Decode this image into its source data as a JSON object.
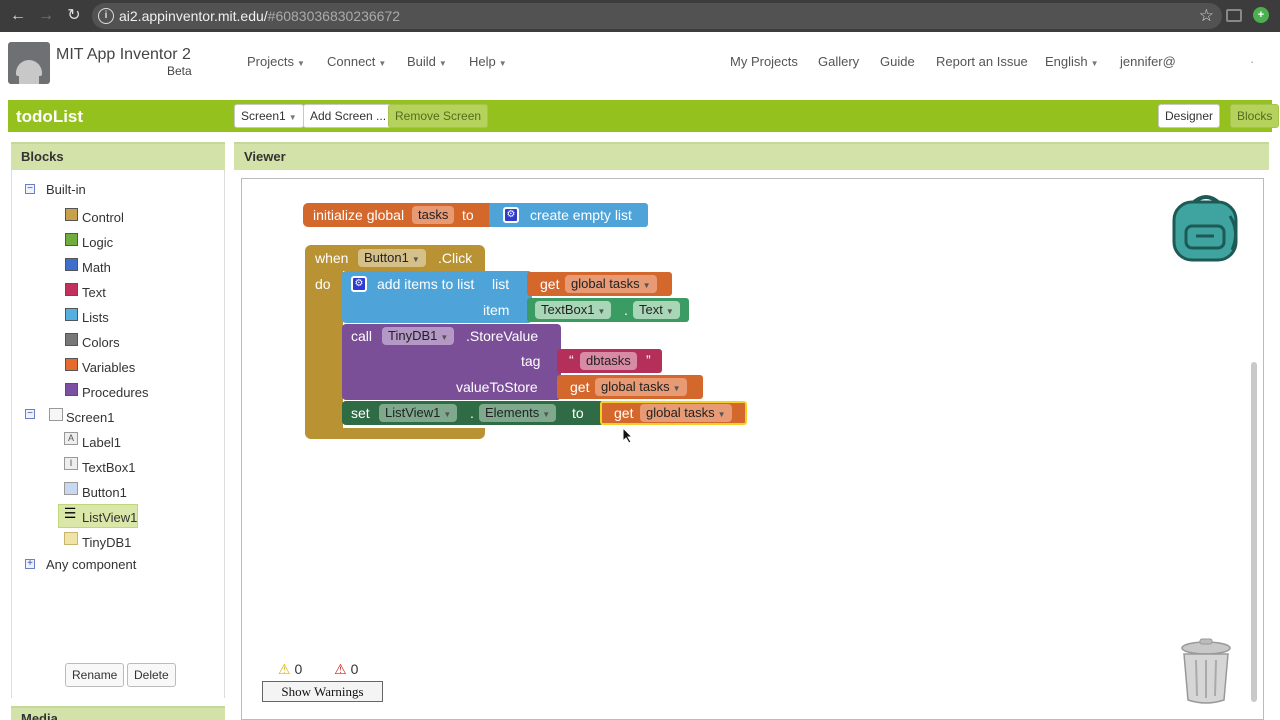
{
  "browser": {
    "url_host": "ai2.appinventor.mit.edu/",
    "url_hash": "#6083036830236672"
  },
  "app": {
    "brand_title": "MIT App Inventor 2",
    "brand_sub": "Beta",
    "menus": [
      "Projects",
      "Connect",
      "Build",
      "Help"
    ],
    "right_links": [
      "My Projects",
      "Gallery",
      "Guide",
      "Report an Issue"
    ],
    "language": "English",
    "user": "jennifer@",
    "extra": "·"
  },
  "toolbar": {
    "project_name": "todoList",
    "screen_select": "Screen1",
    "add_screen": "Add Screen ...",
    "remove_screen": "Remove Screen",
    "designer": "Designer",
    "blocks": "Blocks"
  },
  "blocks_panel": {
    "title": "Blocks",
    "builtin_label": "Built-in",
    "builtin_toggle": "⊖",
    "builtin_items": [
      {
        "label": "Control",
        "color": "#c8a24a"
      },
      {
        "label": "Logic",
        "color": "#6fae3d"
      },
      {
        "label": "Math",
        "color": "#3f6fcc"
      },
      {
        "label": "Text",
        "color": "#c2305d"
      },
      {
        "label": "Lists",
        "color": "#53b0e0"
      },
      {
        "label": "Colors",
        "color": "#777777"
      },
      {
        "label": "Variables",
        "color": "#e56a2d"
      },
      {
        "label": "Procedures",
        "color": "#7c4fa3"
      }
    ],
    "screen_label": "Screen1",
    "screen_toggle": "⊖",
    "components": [
      "Label1",
      "TextBox1",
      "Button1",
      "ListView1",
      "TinyDB1"
    ],
    "any_component": "Any component",
    "any_toggle": "⊕",
    "rename": "Rename",
    "delete": "Delete",
    "media_cut": "Media"
  },
  "viewer": {
    "title": "Viewer",
    "init_block": {
      "kw": "initialize global",
      "name": "tasks",
      "to": "to",
      "create": "create empty list"
    },
    "event_block": {
      "when": "when",
      "component": "Button1",
      "event": ".Click",
      "do": "do"
    },
    "add_items": {
      "label": "add items to list",
      "list": "list",
      "get": "get",
      "var": "global tasks",
      "item": "item",
      "textbox": "TextBox1",
      "dot": ".",
      "prop": "Text"
    },
    "store": {
      "call": "call",
      "component": "TinyDB1",
      "method": ".StoreValue",
      "tag": "tag",
      "tag_value": "dbtasks",
      "quote_open": "“",
      "quote_close": "”",
      "value_label": "valueToStore",
      "get": "get",
      "var": "global tasks"
    },
    "set_block": {
      "set": "set",
      "component": "ListView1",
      "dot": ".",
      "prop": "Elements",
      "to": "to",
      "get": "get",
      "var": "global tasks"
    },
    "warnings_count": "0",
    "errors_count": "0",
    "show_warnings": "Show Warnings"
  },
  "colors": {
    "green": "#95c11e",
    "variables": "#d4672b",
    "lists": "#4ea3d8",
    "control": "#b89233",
    "components_method": "#7b4f98",
    "text": "#b4305a",
    "setter": "#2f6b45",
    "textbox": "#3a9b63"
  }
}
